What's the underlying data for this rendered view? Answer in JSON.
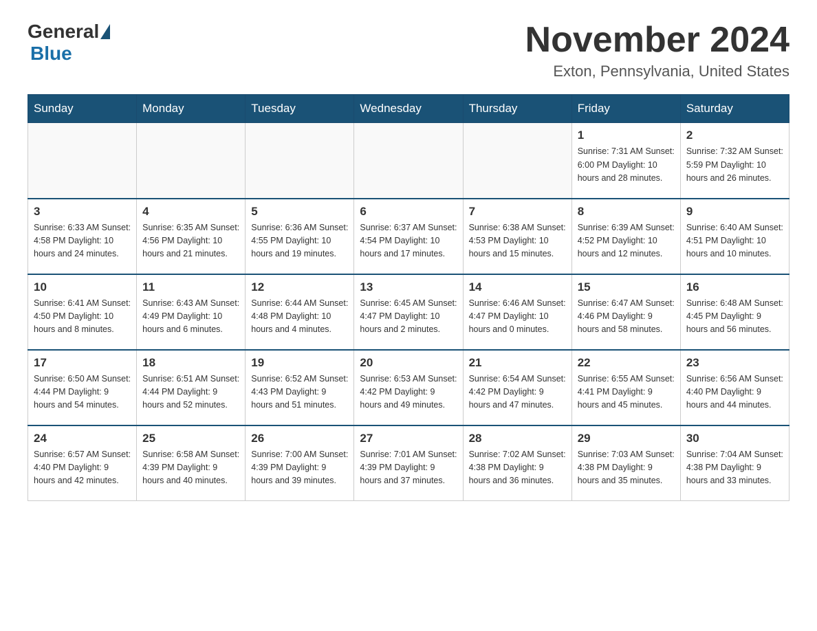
{
  "logo": {
    "general": "General",
    "blue": "Blue"
  },
  "title": "November 2024",
  "location": "Exton, Pennsylvania, United States",
  "weekdays": [
    "Sunday",
    "Monday",
    "Tuesday",
    "Wednesday",
    "Thursday",
    "Friday",
    "Saturday"
  ],
  "weeks": [
    [
      {
        "day": "",
        "info": ""
      },
      {
        "day": "",
        "info": ""
      },
      {
        "day": "",
        "info": ""
      },
      {
        "day": "",
        "info": ""
      },
      {
        "day": "",
        "info": ""
      },
      {
        "day": "1",
        "info": "Sunrise: 7:31 AM\nSunset: 6:00 PM\nDaylight: 10 hours\nand 28 minutes."
      },
      {
        "day": "2",
        "info": "Sunrise: 7:32 AM\nSunset: 5:59 PM\nDaylight: 10 hours\nand 26 minutes."
      }
    ],
    [
      {
        "day": "3",
        "info": "Sunrise: 6:33 AM\nSunset: 4:58 PM\nDaylight: 10 hours\nand 24 minutes."
      },
      {
        "day": "4",
        "info": "Sunrise: 6:35 AM\nSunset: 4:56 PM\nDaylight: 10 hours\nand 21 minutes."
      },
      {
        "day": "5",
        "info": "Sunrise: 6:36 AM\nSunset: 4:55 PM\nDaylight: 10 hours\nand 19 minutes."
      },
      {
        "day": "6",
        "info": "Sunrise: 6:37 AM\nSunset: 4:54 PM\nDaylight: 10 hours\nand 17 minutes."
      },
      {
        "day": "7",
        "info": "Sunrise: 6:38 AM\nSunset: 4:53 PM\nDaylight: 10 hours\nand 15 minutes."
      },
      {
        "day": "8",
        "info": "Sunrise: 6:39 AM\nSunset: 4:52 PM\nDaylight: 10 hours\nand 12 minutes."
      },
      {
        "day": "9",
        "info": "Sunrise: 6:40 AM\nSunset: 4:51 PM\nDaylight: 10 hours\nand 10 minutes."
      }
    ],
    [
      {
        "day": "10",
        "info": "Sunrise: 6:41 AM\nSunset: 4:50 PM\nDaylight: 10 hours\nand 8 minutes."
      },
      {
        "day": "11",
        "info": "Sunrise: 6:43 AM\nSunset: 4:49 PM\nDaylight: 10 hours\nand 6 minutes."
      },
      {
        "day": "12",
        "info": "Sunrise: 6:44 AM\nSunset: 4:48 PM\nDaylight: 10 hours\nand 4 minutes."
      },
      {
        "day": "13",
        "info": "Sunrise: 6:45 AM\nSunset: 4:47 PM\nDaylight: 10 hours\nand 2 minutes."
      },
      {
        "day": "14",
        "info": "Sunrise: 6:46 AM\nSunset: 4:47 PM\nDaylight: 10 hours\nand 0 minutes."
      },
      {
        "day": "15",
        "info": "Sunrise: 6:47 AM\nSunset: 4:46 PM\nDaylight: 9 hours\nand 58 minutes."
      },
      {
        "day": "16",
        "info": "Sunrise: 6:48 AM\nSunset: 4:45 PM\nDaylight: 9 hours\nand 56 minutes."
      }
    ],
    [
      {
        "day": "17",
        "info": "Sunrise: 6:50 AM\nSunset: 4:44 PM\nDaylight: 9 hours\nand 54 minutes."
      },
      {
        "day": "18",
        "info": "Sunrise: 6:51 AM\nSunset: 4:44 PM\nDaylight: 9 hours\nand 52 minutes."
      },
      {
        "day": "19",
        "info": "Sunrise: 6:52 AM\nSunset: 4:43 PM\nDaylight: 9 hours\nand 51 minutes."
      },
      {
        "day": "20",
        "info": "Sunrise: 6:53 AM\nSunset: 4:42 PM\nDaylight: 9 hours\nand 49 minutes."
      },
      {
        "day": "21",
        "info": "Sunrise: 6:54 AM\nSunset: 4:42 PM\nDaylight: 9 hours\nand 47 minutes."
      },
      {
        "day": "22",
        "info": "Sunrise: 6:55 AM\nSunset: 4:41 PM\nDaylight: 9 hours\nand 45 minutes."
      },
      {
        "day": "23",
        "info": "Sunrise: 6:56 AM\nSunset: 4:40 PM\nDaylight: 9 hours\nand 44 minutes."
      }
    ],
    [
      {
        "day": "24",
        "info": "Sunrise: 6:57 AM\nSunset: 4:40 PM\nDaylight: 9 hours\nand 42 minutes."
      },
      {
        "day": "25",
        "info": "Sunrise: 6:58 AM\nSunset: 4:39 PM\nDaylight: 9 hours\nand 40 minutes."
      },
      {
        "day": "26",
        "info": "Sunrise: 7:00 AM\nSunset: 4:39 PM\nDaylight: 9 hours\nand 39 minutes."
      },
      {
        "day": "27",
        "info": "Sunrise: 7:01 AM\nSunset: 4:39 PM\nDaylight: 9 hours\nand 37 minutes."
      },
      {
        "day": "28",
        "info": "Sunrise: 7:02 AM\nSunset: 4:38 PM\nDaylight: 9 hours\nand 36 minutes."
      },
      {
        "day": "29",
        "info": "Sunrise: 7:03 AM\nSunset: 4:38 PM\nDaylight: 9 hours\nand 35 minutes."
      },
      {
        "day": "30",
        "info": "Sunrise: 7:04 AM\nSunset: 4:38 PM\nDaylight: 9 hours\nand 33 minutes."
      }
    ]
  ]
}
